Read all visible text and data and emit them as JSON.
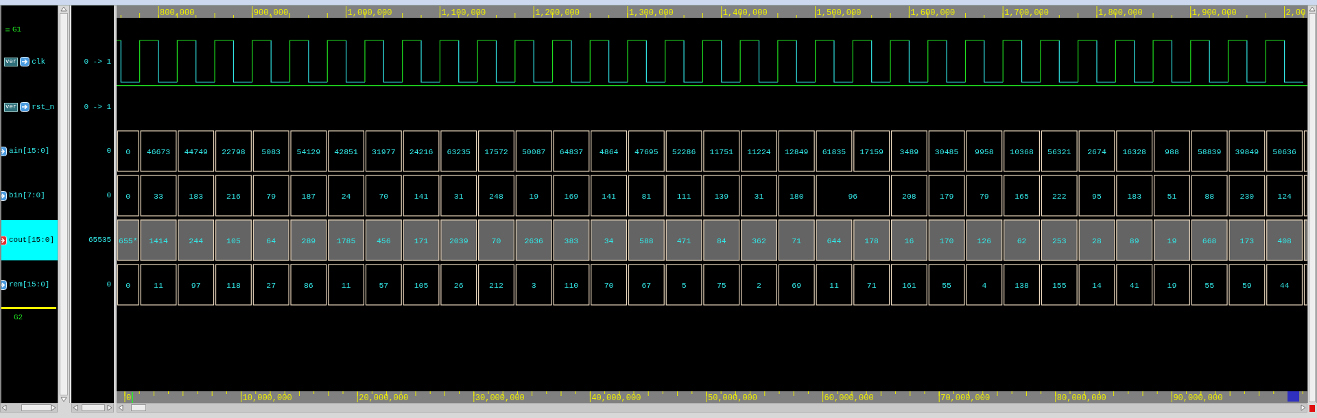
{
  "top_ruler": {
    "labels": [
      "800,000",
      "900,000",
      "1,000,000",
      "1,100,000",
      "1,200,000",
      "1,300,000",
      "1,400,000",
      "1,500,000",
      "1,600,000",
      "1,700,000",
      "1,800,000",
      "1,900,000",
      "2,00"
    ]
  },
  "signals": [
    {
      "kind": "group",
      "name": "G1",
      "marker": false
    },
    {
      "kind": "clock",
      "name": "clk",
      "badge": "ver",
      "color": "#4a9be0",
      "icon_clipped": false,
      "value": "0 -> 1",
      "selected": false
    },
    {
      "kind": "bit",
      "name": "rst_n",
      "badge": "ver",
      "color": "#4a9be0",
      "icon_clipped": false,
      "value": "0 -> 1",
      "selected": false,
      "high": true
    },
    {
      "kind": "bus",
      "name": "ain[15:0]",
      "color": "#4a9be0",
      "icon_clipped": true,
      "value": "0",
      "selected": false,
      "segments": [
        "0",
        "46673",
        "44749",
        "22798",
        "5083",
        "54129",
        "42851",
        "31977",
        "24216",
        "63235",
        "17572",
        "50087",
        "64837",
        "4864",
        "47695",
        "52286",
        "11751",
        "11224",
        "12849",
        "61835",
        "17159",
        "3489",
        "30485",
        "9958",
        "10368",
        "56321",
        "2674",
        "16328",
        "988",
        "58839",
        "39849",
        "50636"
      ]
    },
    {
      "kind": "bus",
      "name": "bin[7:0]",
      "color": "#4a9be0",
      "icon_clipped": true,
      "value": "0",
      "selected": false,
      "segments": [
        {
          "value": "0",
          "wide": false
        },
        {
          "value": "33",
          "wide": false
        },
        {
          "value": "183",
          "wide": false
        },
        {
          "value": "216",
          "wide": false
        },
        {
          "value": "79",
          "wide": false
        },
        {
          "value": "187",
          "wide": false
        },
        {
          "value": "24",
          "wide": false
        },
        {
          "value": "70",
          "wide": false
        },
        {
          "value": "141",
          "wide": false
        },
        {
          "value": "31",
          "wide": false
        },
        {
          "value": "248",
          "wide": false
        },
        {
          "value": "19",
          "wide": false
        },
        {
          "value": "169",
          "wide": false
        },
        {
          "value": "141",
          "wide": false
        },
        {
          "value": "81",
          "wide": false
        },
        {
          "value": "111",
          "wide": false
        },
        {
          "value": "139",
          "wide": false
        },
        {
          "value": "31",
          "wide": false
        },
        {
          "value": "180",
          "wide": false
        },
        {
          "value": "96",
          "wide": true
        },
        {
          "value": "208",
          "wide": false
        },
        {
          "value": "179",
          "wide": false
        },
        {
          "value": "79",
          "wide": false
        },
        {
          "value": "165",
          "wide": false
        },
        {
          "value": "222",
          "wide": false
        },
        {
          "value": "95",
          "wide": false
        },
        {
          "value": "183",
          "wide": false
        },
        {
          "value": "51",
          "wide": false
        },
        {
          "value": "88",
          "wide": false
        },
        {
          "value": "230",
          "wide": false
        },
        {
          "value": "124",
          "wide": false
        }
      ]
    },
    {
      "kind": "bus",
      "name": "cout[15:0]",
      "color": "#e03030",
      "icon_clipped": true,
      "value": "65535",
      "selected": true,
      "segments": [
        "655*",
        "1414",
        "244",
        "105",
        "64",
        "289",
        "1785",
        "456",
        "171",
        "2039",
        "70",
        "2636",
        "383",
        "34",
        "588",
        "471",
        "84",
        "362",
        "71",
        "644",
        "178",
        "16",
        "170",
        "126",
        "62",
        "253",
        "28",
        "89",
        "19",
        "668",
        "173",
        "408"
      ]
    },
    {
      "kind": "bus",
      "name": "rem[15:0]",
      "color": "#4a9be0",
      "icon_clipped": true,
      "value": "0",
      "selected": false,
      "segments": [
        "0",
        "11",
        "97",
        "118",
        "27",
        "86",
        "11",
        "57",
        "105",
        "26",
        "212",
        "3",
        "110",
        "70",
        "67",
        "5",
        "75",
        "2",
        "69",
        "11",
        "71",
        "161",
        "55",
        "4",
        "138",
        "155",
        "14",
        "41",
        "19",
        "55",
        "59",
        "44"
      ]
    },
    {
      "kind": "group",
      "name": "G2",
      "marker": true
    }
  ],
  "bottom_ruler": {
    "labels": [
      "0",
      "10,000,000",
      "20,000,000",
      "30,000,000",
      "40,000,000",
      "50,000,000",
      "60,000,000",
      "70,000,000",
      "80,000,000",
      "90,000,000"
    ]
  }
}
